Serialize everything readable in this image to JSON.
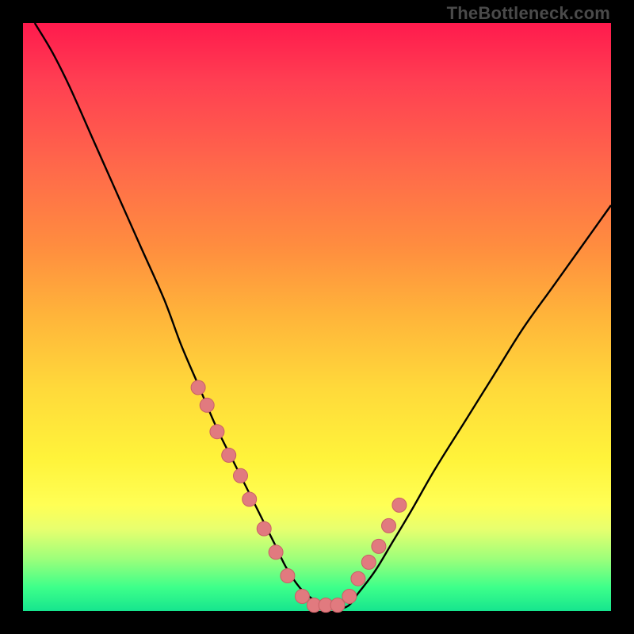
{
  "watermark": "TheBottleneck.com",
  "colors": {
    "curve_stroke": "#000000",
    "marker_fill": "#e17a7f",
    "marker_stroke": "#c96066",
    "gradient_top": "#ff1a4d",
    "gradient_bottom": "#16e58e"
  },
  "chart_data": {
    "type": "line",
    "title": "",
    "xlabel": "",
    "ylabel": "",
    "xlim": [
      0,
      100
    ],
    "ylim": [
      0,
      100
    ],
    "curve": {
      "name": "bottleneck-curve",
      "x": [
        2,
        5,
        8,
        12,
        16,
        20,
        24,
        27,
        30,
        33,
        36,
        39,
        41,
        43,
        45,
        48,
        52,
        55,
        57,
        60,
        63,
        66,
        70,
        75,
        80,
        85,
        90,
        95,
        100
      ],
      "y": [
        100,
        95,
        89,
        80,
        71,
        62,
        53,
        45,
        38,
        31,
        25,
        19,
        15,
        11,
        7,
        3,
        0.7,
        0.7,
        3,
        7,
        12,
        17,
        24,
        32,
        40,
        48,
        55,
        62,
        69
      ]
    },
    "markers": {
      "name": "highlight-points",
      "x": [
        29.8,
        31.3,
        33.0,
        35.0,
        37.0,
        38.5,
        41.0,
        43.0,
        45.0,
        47.5,
        49.5,
        51.5,
        53.5,
        55.5,
        57.0,
        58.8,
        60.5,
        62.2,
        64.0
      ],
      "y": [
        38.0,
        35.0,
        30.5,
        26.5,
        23.0,
        19.0,
        14.0,
        10.0,
        6.0,
        2.5,
        1.0,
        1.0,
        1.0,
        2.5,
        5.5,
        8.3,
        11.0,
        14.5,
        18.0
      ]
    }
  }
}
